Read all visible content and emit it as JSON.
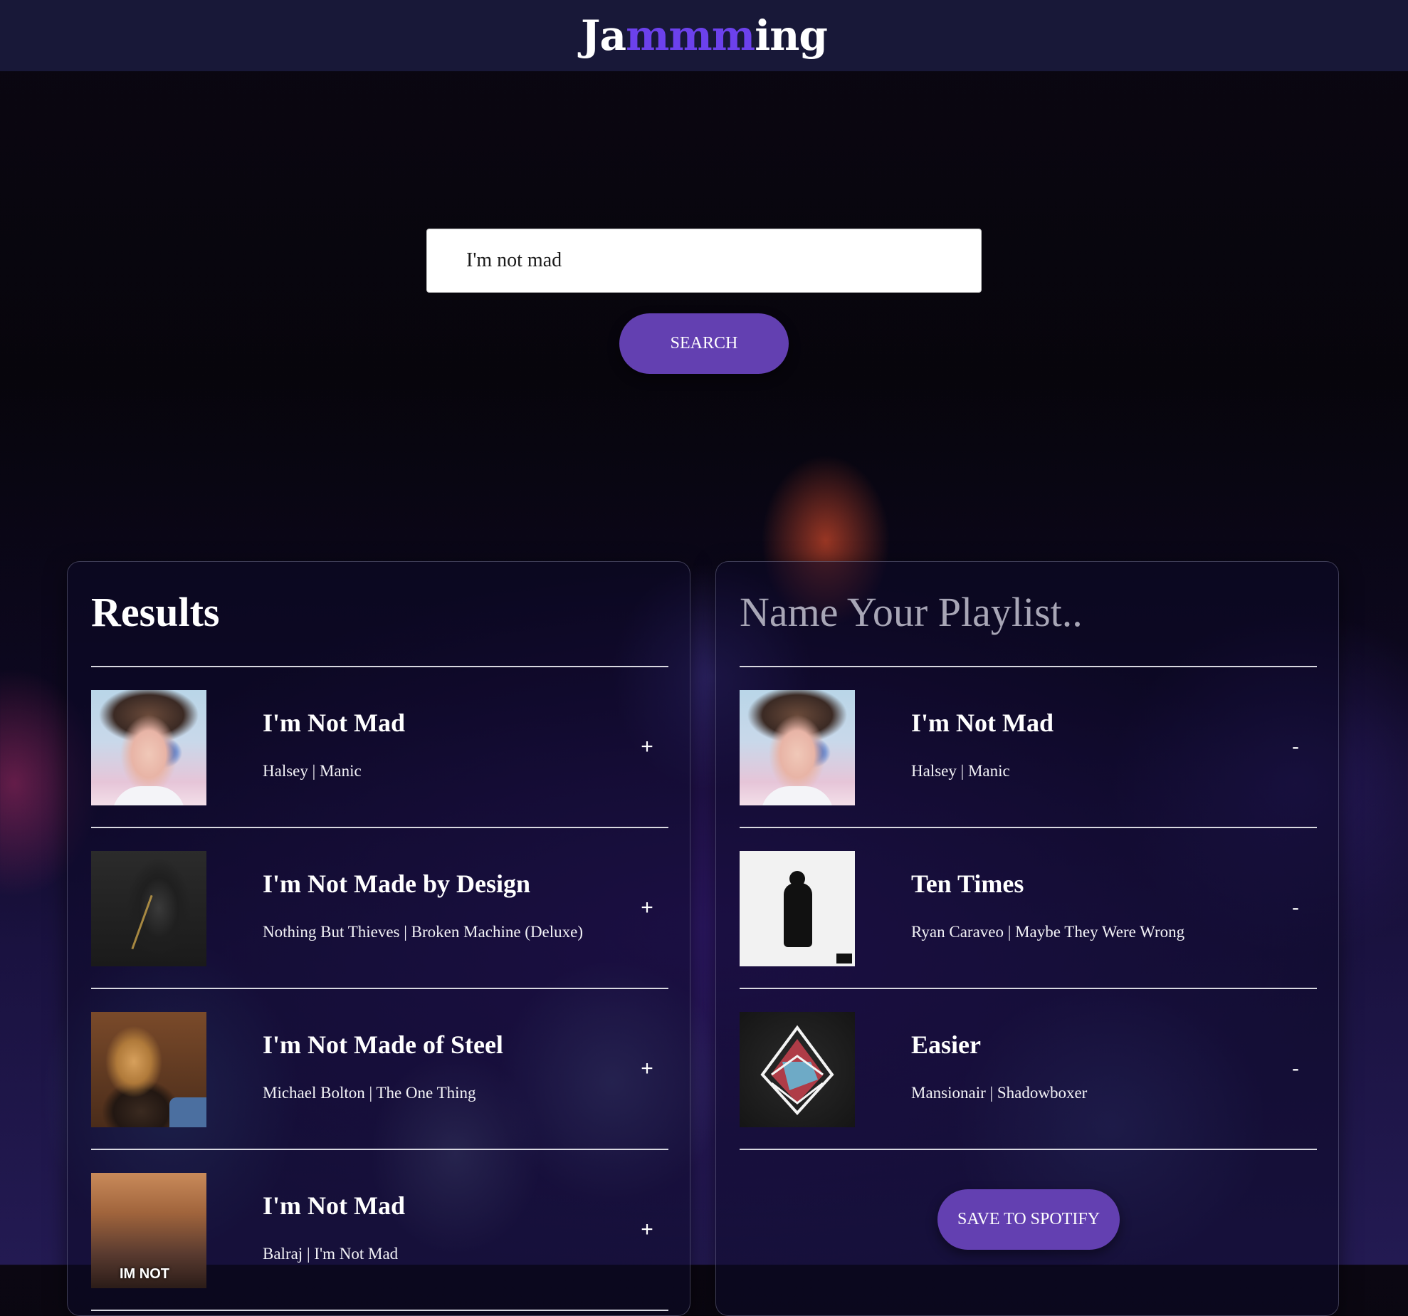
{
  "header": {
    "logo_prefix": "Ja",
    "logo_accent": "mmm",
    "logo_suffix": "ing",
    "accent_color": "#6c41ec"
  },
  "search": {
    "value": "I'm not mad",
    "button_label": "SEARCH"
  },
  "results": {
    "title": "Results",
    "tracks": [
      {
        "name": "I'm Not Mad",
        "meta": "Halsey | Manic",
        "action": "+",
        "cover_icon": "album-cover-halsey-manic"
      },
      {
        "name": "I'm Not Made by Design",
        "meta": "Nothing But Thieves | Broken Machine (Deluxe)",
        "action": "+",
        "cover_icon": "album-cover-broken-machine"
      },
      {
        "name": "I'm Not Made of Steel",
        "meta": "Michael Bolton | The One Thing",
        "action": "+",
        "cover_icon": "album-cover-the-one-thing"
      },
      {
        "name": "I'm Not Mad",
        "meta": "Balraj | I'm Not Mad",
        "action": "+",
        "cover_icon": "album-cover-im-not-mad-balraj"
      }
    ]
  },
  "playlist": {
    "name_placeholder": "Name Your Playlist..",
    "tracks": [
      {
        "name": "I'm Not Mad",
        "meta": "Halsey | Manic",
        "action": "-",
        "cover_icon": "album-cover-halsey-manic"
      },
      {
        "name": "Ten Times",
        "meta": "Ryan Caraveo | Maybe They Were Wrong",
        "action": "-",
        "cover_icon": "album-cover-maybe-they-were-wrong"
      },
      {
        "name": "Easier",
        "meta": "Mansionair | Shadowboxer",
        "action": "-",
        "cover_icon": "album-cover-shadowboxer"
      }
    ],
    "save_label": "SAVE TO SPOTIFY"
  },
  "colors": {
    "button": "#6340b1",
    "header_bg": "#181838"
  }
}
